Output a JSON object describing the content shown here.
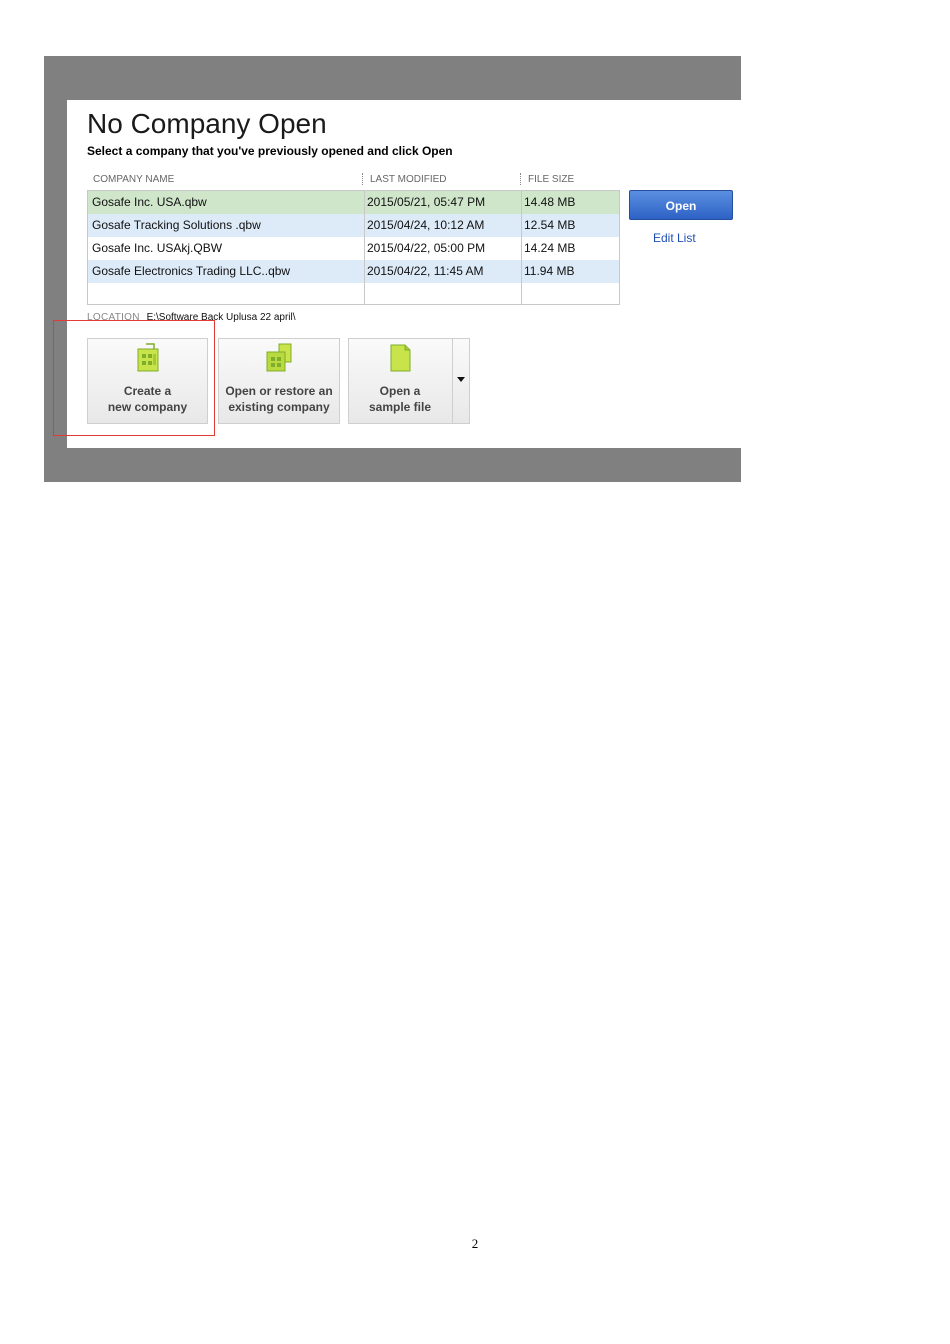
{
  "window": {
    "title": "No Company Open",
    "subtitle": "Select a company that you've previously opened and click Open"
  },
  "company_list": {
    "columns": [
      "COMPANY NAME",
      "LAST MODIFIED",
      "FILE SIZE"
    ],
    "rows": [
      {
        "name": "Gosafe Inc. USA.qbw",
        "modified": "2015/05/21, 05:47 PM",
        "size": "14.48 MB",
        "selected": true
      },
      {
        "name": "Gosafe Tracking Solutions .qbw",
        "modified": "2015/04/24, 10:12 AM",
        "size": "12.54 MB"
      },
      {
        "name": "Gosafe Inc. USAkj.QBW",
        "modified": "2015/04/22, 05:00 PM",
        "size": "14.24 MB"
      },
      {
        "name": "Gosafe Electronics Trading LLC..qbw",
        "modified": "2015/04/22, 11:45 AM",
        "size": "11.94 MB"
      }
    ]
  },
  "actions": {
    "open_label": "Open",
    "edit_list_label": "Edit List"
  },
  "location": {
    "label": "LOCATION",
    "value": "E:\\Software Back Uplusa 22 april\\"
  },
  "buttons": {
    "create": {
      "line1": "Create a",
      "line2": "new company",
      "icon": "new-company-icon"
    },
    "open_restore": {
      "line1": "Open or restore an",
      "line2": "existing company",
      "icon": "open-company-icon"
    },
    "sample": {
      "line1": "Open a",
      "line2": "sample file",
      "icon": "sample-file-icon"
    }
  },
  "footer": {
    "page_number": "2"
  },
  "colors": {
    "selected_row": "#cfe6cb",
    "alt_row": "#ddeaf8",
    "accent_blue": "#2d62c6",
    "highlight_red": "#e53935",
    "frame_gray": "#808080"
  }
}
